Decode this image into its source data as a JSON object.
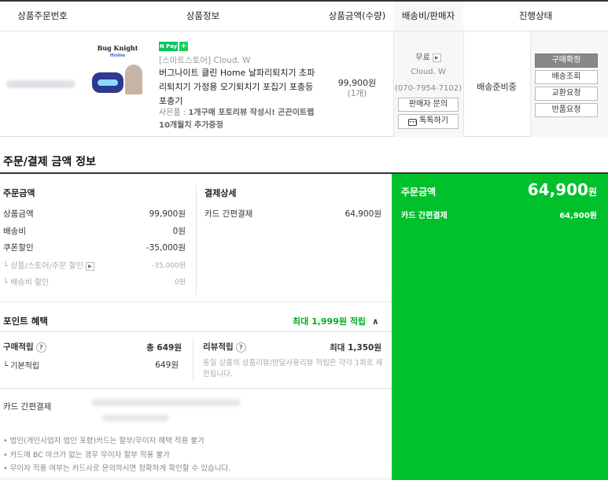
{
  "order_table": {
    "headers": {
      "order_no": "상품주문번호",
      "product_info": "상품정보",
      "price_qty": "상품금액(수량)",
      "shipping_seller": "배송비/판매자",
      "status": "진행상태"
    },
    "item": {
      "brand": "Bug Knight",
      "brand_sub": "Home",
      "npay_label": "N Pay",
      "npay_plus": "+",
      "store": "[스마트스토어] Cloud. W",
      "product_name": "버그나이트 클린 Home 날파리퇴치기 초파리퇴치기 가정용 모기퇴치기 포집기 포충등 포충기",
      "gift_prefix": "사은품 : ",
      "gift_bold": "1개구매 포토리뷰 작성시! 곤끈이트랩 10개월치 추가증정",
      "price": "99,900원",
      "quantity": "(1개)",
      "shipping_fee": "무료",
      "seller": "Cloud. W",
      "phone": "(070-7954-7102)",
      "seller_inquiry_button": "판매자 문의",
      "talk_button": "톡톡하기",
      "ship_status": "배송준비중",
      "actions": {
        "confirm": "구매확정",
        "track": "배송조회",
        "exchange": "교환요청",
        "return": "반품요청"
      }
    }
  },
  "payment": {
    "section_title": "주문/결제 금액 정보",
    "order_amount": {
      "title": "주문금액",
      "rows": [
        {
          "label": "상품금액",
          "value": "99,900원"
        },
        {
          "label": "배송비",
          "value": "0원"
        },
        {
          "label": "쿠폰할인",
          "value": "-35,000원"
        }
      ],
      "sub_rows": [
        {
          "label": "└ 상품/스토어/주문 할인",
          "value": "-35,000원"
        },
        {
          "label": "└ 배송비 할인",
          "value": "0원"
        }
      ]
    },
    "detail": {
      "title": "결제상세",
      "method": "카드 간편결제",
      "amount": "64,900원"
    },
    "points": {
      "title": "포인트 혜택",
      "max_label": "최대 1,999원 적립",
      "purchase_title": "구매적립",
      "purchase_total": "총 649원",
      "basic_label": "└ 기본적립",
      "basic_value": "649원",
      "review_title": "리뷰적립",
      "review_max": "최대 1,350원",
      "review_note": "동일 상품의 상품리뷰/한달사용리뷰 적립은 각각 1회로 제한됩니다."
    },
    "card": {
      "label": "카드 간편결제",
      "notes": [
        "• 법인(개인사업자 법인 포함)카드는 할부/무이자 혜택 적용 불가",
        "• 카드에 BC 마크가 없는 경우 무이자 할부 적용 불가",
        "• 무이자 적용 여부는 카드사로 문의하시면 정확하게 확인할 수 있습니다."
      ]
    },
    "summary": {
      "title": "주문금액",
      "amount": "64,900",
      "unit": "원",
      "method": "카드 간편결제",
      "method_amount": "64,900원"
    }
  },
  "colors": {
    "accent_green": "#00c02c",
    "point_green": "#00b01e",
    "npay_green": "#03c75a"
  },
  "icons": [
    "arrow-right-icon",
    "talk-icon",
    "question-icon",
    "chevron-up-icon"
  ]
}
